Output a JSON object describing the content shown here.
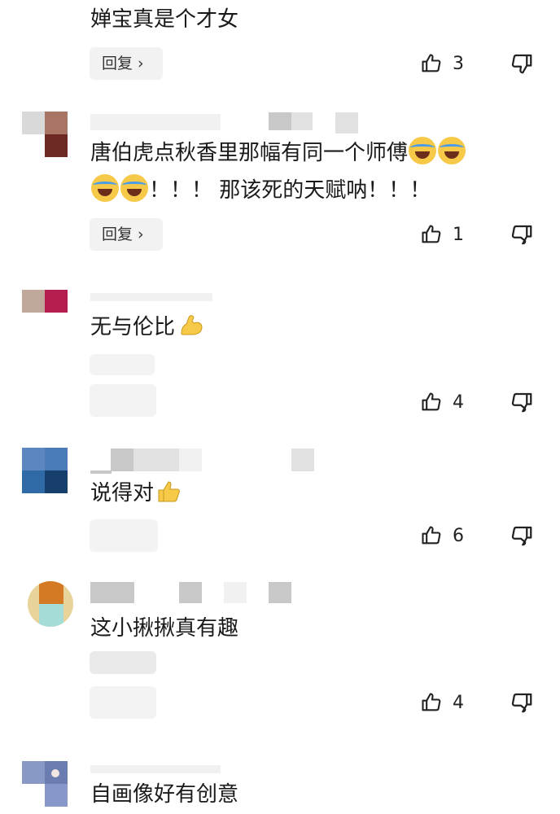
{
  "comments": [
    {
      "text": "婵宝真是个才女",
      "reply_label": "回复 ›",
      "likes": "3"
    },
    {
      "text_line1": "唐伯虎点秋香里那幅有同一个师傅",
      "text_line2": "！！！ 那该死的天赋呐！！！",
      "reply_label": "回复 ›",
      "likes": "1"
    },
    {
      "text": "无与伦比",
      "likes": "4"
    },
    {
      "text": "说得对",
      "likes": "6"
    },
    {
      "text": "这小揪揪真有趣",
      "likes": "4"
    },
    {
      "text": "自画像好有创意"
    }
  ],
  "icons": {
    "like": "thumbs-up-outline",
    "dislike": "thumbs-down-outline",
    "emoji_laugh_cry": "rolling-on-floor-laughing",
    "emoji_muscle": "flexed-biceps",
    "emoji_thumbs": "thumbs-up-emoji"
  },
  "colors": {
    "text": "#1a1a1a",
    "reply_bg": "#f2f2f2",
    "emoji": "#f7c948"
  }
}
